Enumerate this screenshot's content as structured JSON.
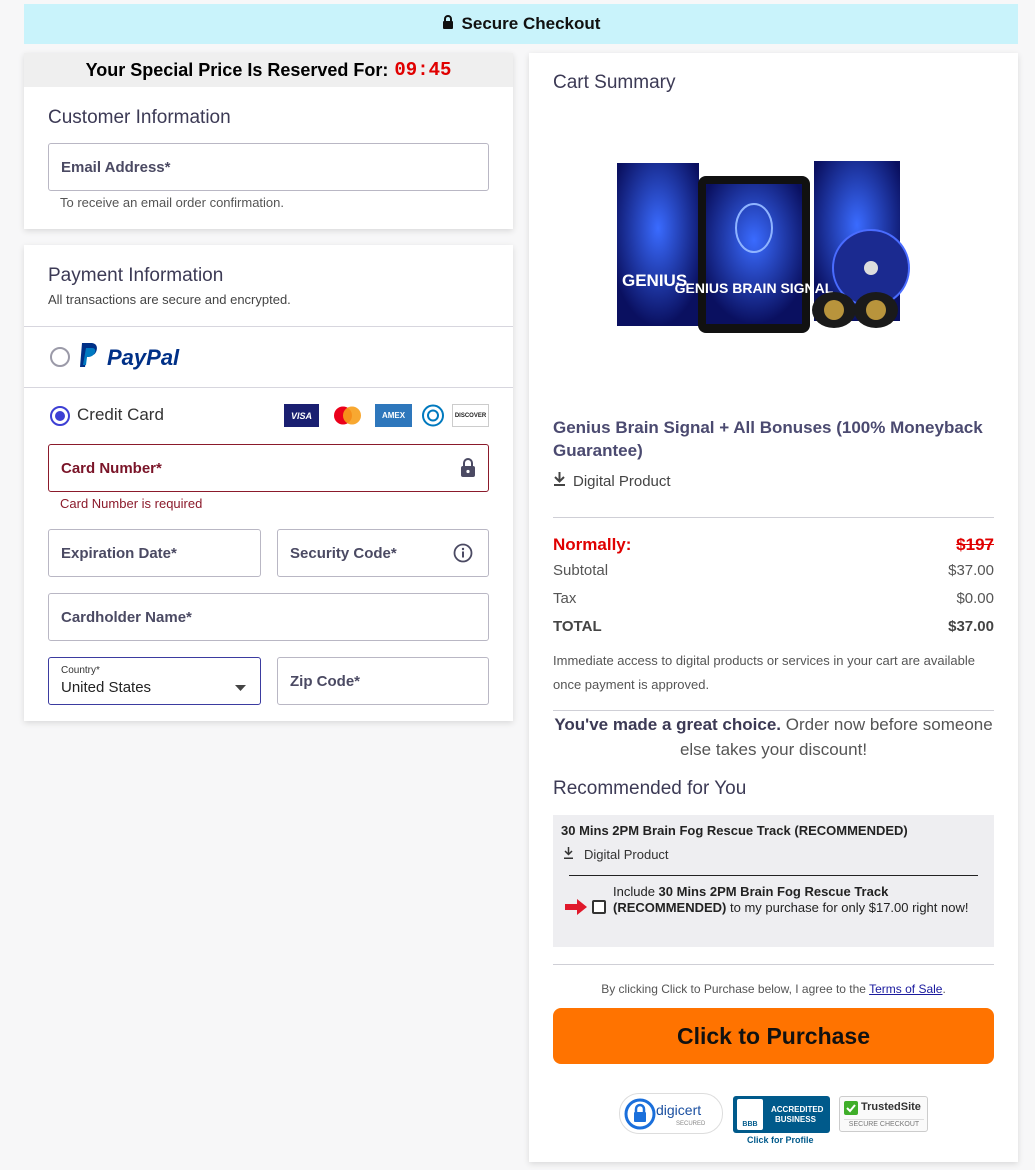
{
  "header": {
    "title": "Secure Checkout"
  },
  "timer": {
    "label": "Your Special Price Is Reserved For:",
    "value": "09:45"
  },
  "customer": {
    "title": "Customer Information",
    "email_placeholder": "Email Address*",
    "email_helper": "To receive an email order confirmation."
  },
  "payment": {
    "title": "Payment Information",
    "subtitle": "All transactions are secure and encrypted.",
    "paypal_label": "PayPal",
    "credit_label": "Credit Card",
    "card_brands": [
      "VISA",
      "MC",
      "AMEX",
      "DC",
      "DISCOVER"
    ],
    "card_number_placeholder": "Card Number*",
    "card_number_error": "Card Number is required",
    "expiration_placeholder": "Expiration Date*",
    "security_placeholder": "Security Code*",
    "cardholder_placeholder": "Cardholder Name*",
    "country_label": "Country*",
    "country_value": "United States",
    "zip_placeholder": "Zip Code*"
  },
  "cart": {
    "title": "Cart Summary",
    "product_image_text": "GENIUS BRAIN SIGNAL",
    "product_box_text": "GENIUS",
    "product_name": "Genius Brain Signal + All Bonuses (100% Moneyback Guarantee)",
    "product_type": "Digital Product",
    "normally_label": "Normally:",
    "normally_value": "$197",
    "subtotal_label": "Subtotal",
    "subtotal_value": "$37.00",
    "tax_label": "Tax",
    "tax_value": "$0.00",
    "total_label": "TOTAL",
    "total_value": "$37.00",
    "access_note": "Immediate access to digital products or services in your cart are available once payment is approved.",
    "choice_bold": "You've made a great choice.",
    "choice_rest": " Order now before someone else takes your discount!",
    "rec_title": "Recommended for You",
    "rec_item_title": "30 Mins 2PM Brain Fog Rescue Track (RECOMMENDED)",
    "rec_item_type": "Digital Product",
    "rec_include_prefix": "Include ",
    "rec_include_bold": "30 Mins 2PM Brain Fog Rescue Track (RECOMMENDED)",
    "rec_include_suffix": " to my purchase for only $17.00 right now!",
    "terms_prefix": "By clicking Click to Purchase below, I agree to the ",
    "terms_link": "Terms of Sale",
    "terms_suffix": ".",
    "purchase_label": "Click to Purchase"
  },
  "badges": {
    "digicert": "digicert",
    "digicert_sub": "SECURED",
    "bbb_line1": "ACCREDITED",
    "bbb_line2": "BUSINESS",
    "bbb_logo": "BBB",
    "bbb_profile": "Click for Profile",
    "trusted": "TrustedSite",
    "trusted_sub": "SECURE CHECKOUT"
  },
  "colors": {
    "accent": "#3d3fd4",
    "purchase": "#ff7300",
    "error": "#8b1a2b",
    "banner": "#c9f3fb"
  }
}
